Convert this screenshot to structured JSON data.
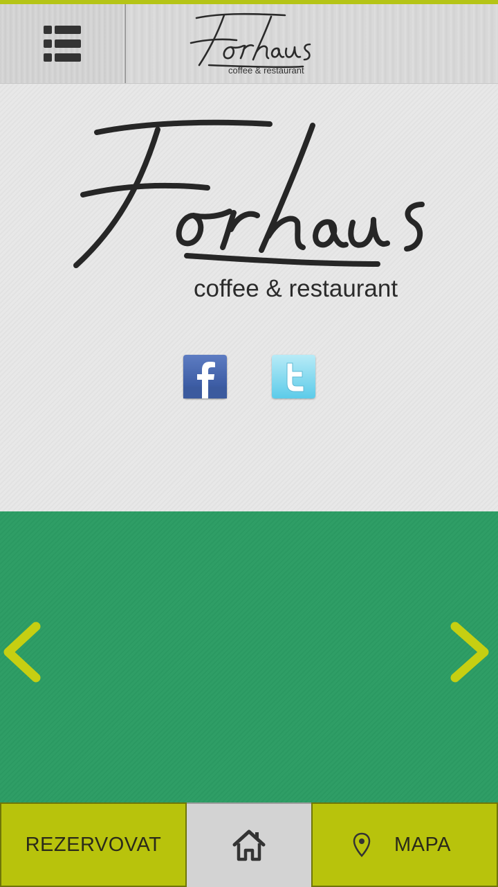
{
  "header": {
    "logo_text": "Forhaus",
    "subtitle": "coffee & restaurant",
    "menu_icon": "list-menu-icon",
    "accent_color": "#b5c416"
  },
  "main": {
    "logo_text": "Forhaus",
    "subtitle": "coffee & restaurant",
    "social": [
      {
        "name": "facebook",
        "icon": "facebook-icon"
      },
      {
        "name": "twitter",
        "icon": "twitter-icon"
      }
    ]
  },
  "carousel": {
    "background_color": "#2f9e66",
    "arrow_color": "#c6cf12",
    "prev_icon": "chevron-left-icon",
    "next_icon": "chevron-right-icon"
  },
  "bottom_nav": {
    "reserve_label": "REZERVOVAT",
    "home_icon": "home-icon",
    "map_label": "MAPA",
    "map_icon": "location-pin-icon",
    "button_color": "#b8c30c"
  }
}
